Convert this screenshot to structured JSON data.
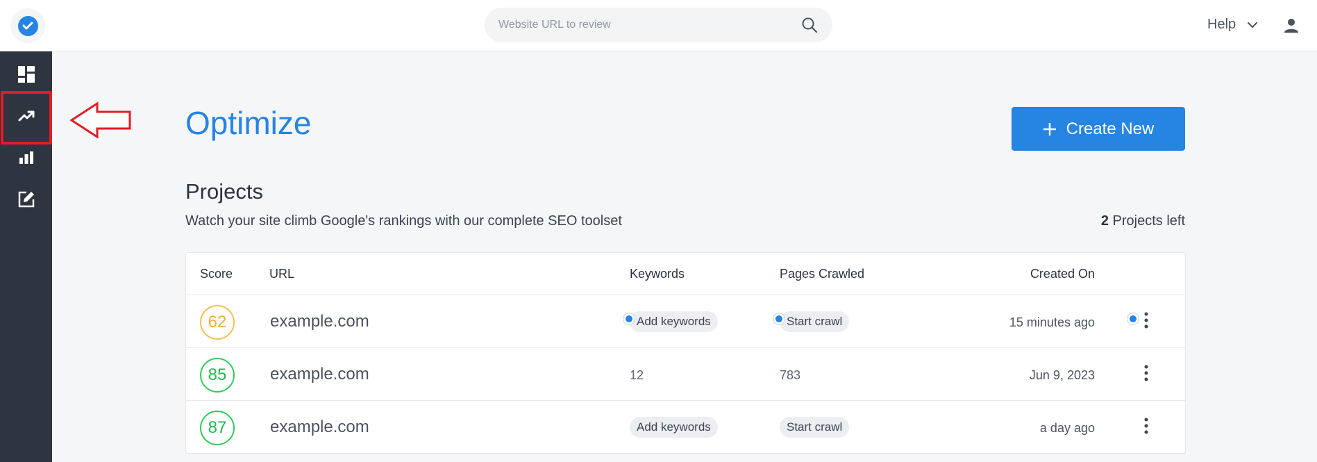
{
  "header": {
    "search_placeholder": "Website URL to review",
    "help_label": "Help"
  },
  "sidebar": {
    "items": [
      {
        "icon": "dashboard-icon"
      },
      {
        "icon": "trending-up-icon",
        "active": true
      },
      {
        "icon": "bar-chart-icon"
      },
      {
        "icon": "edit-icon"
      }
    ]
  },
  "main": {
    "title": "Optimize",
    "create_button_label": "Create New",
    "section_title": "Projects",
    "subtitle": "Watch your site climb Google's rankings with our complete SEO toolset",
    "projects_left_count": "2",
    "projects_left_label": "Projects left"
  },
  "table": {
    "headers": [
      "Score",
      "URL",
      "Keywords",
      "Pages Crawled",
      "Created On"
    ],
    "rows": [
      {
        "score": "62",
        "url": "example.com",
        "keywords": "Add keywords",
        "pages_crawled": "Start crawl",
        "created_on": "15 minutes ago"
      },
      {
        "score": "85",
        "url": "example.com",
        "keywords": "12",
        "pages_crawled": "783",
        "created_on": "Jun 9, 2023"
      },
      {
        "score": "87",
        "url": "example.com",
        "keywords": "Add keywords",
        "pages_crawled": "Start crawl",
        "created_on": "a day ago"
      }
    ]
  },
  "colors": {
    "accent": "#2684e3",
    "sidebar_bg": "#2e3440",
    "score_medium": "#f5c04a",
    "score_good": "#2ecc5a",
    "annotation_red": "#e01e26"
  }
}
